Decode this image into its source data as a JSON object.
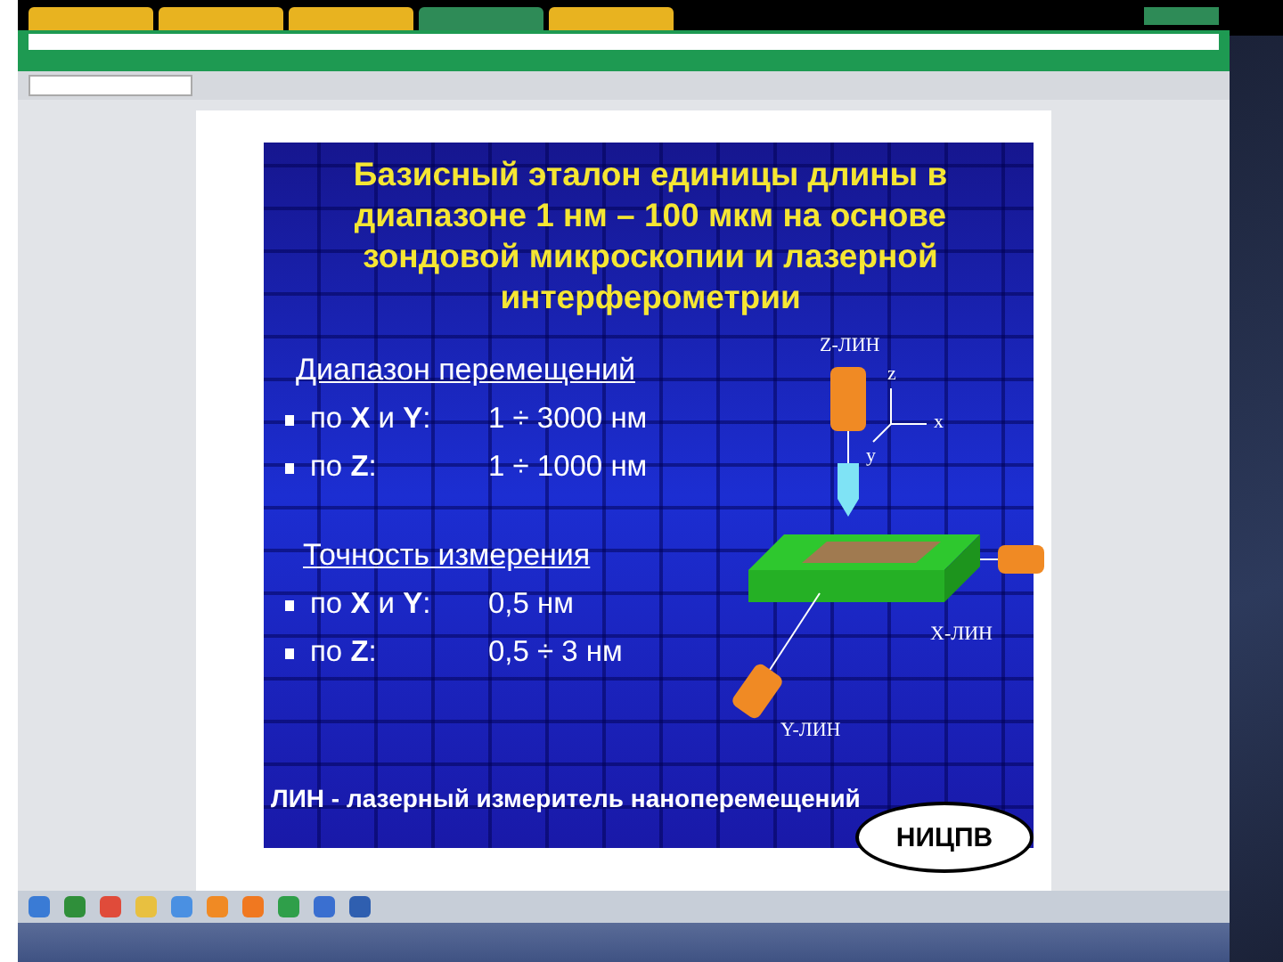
{
  "browser": {
    "tabs": [
      {
        "selected": false
      },
      {
        "selected": false
      },
      {
        "selected": false
      },
      {
        "selected": true
      },
      {
        "selected": false
      }
    ]
  },
  "slide": {
    "title": "Базисный эталон единицы длины в диапазоне 1 нм – 100 мкм на основе зондовой микроскопии и лазерной интерферометрии",
    "sections": [
      {
        "heading": "Диапазон перемещений",
        "items": [
          {
            "label": "по **X** и **Y**:",
            "value": "1 ÷ 3000 нм"
          },
          {
            "label": "по **Z**:",
            "value": "1 ÷ 1000 нм"
          }
        ]
      },
      {
        "heading": "Точность измерения",
        "items": [
          {
            "label": "по **X** и **Y**:",
            "value": "0,5 нм"
          },
          {
            "label": "по **Z**:",
            "value": "0,5 ÷ 3 нм"
          }
        ]
      }
    ],
    "diagram": {
      "z_label": "Z-ЛИН",
      "x_label": "X-ЛИН",
      "y_label": "Y-ЛИН",
      "axes": [
        "z",
        "x",
        "y"
      ]
    },
    "footnote": "ЛИН - лазерный измеритель наноперемещений",
    "badge": "НИЦПВ"
  }
}
